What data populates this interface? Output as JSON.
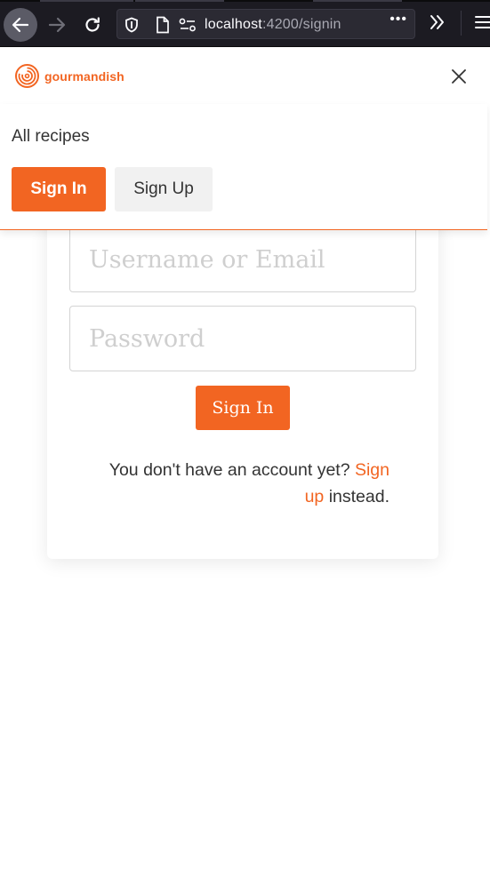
{
  "browser": {
    "url_host": "localhost",
    "url_rest": ":4200/signin",
    "url_more": "•••",
    "icons": [
      "back-arrow-icon",
      "forward-arrow-icon",
      "reload-icon",
      "shield-icon",
      "page-icon",
      "permissions-icon",
      "more-actions-icon",
      "overflow-chevrons-icon",
      "hamburger-menu-icon"
    ]
  },
  "header": {
    "logo_text": "gourmandish",
    "brand_color": "#f26522"
  },
  "menu": {
    "all_recipes": "All recipes",
    "sign_in": "Sign In",
    "sign_up": "Sign Up"
  },
  "signin_form": {
    "username_placeholder": "Username or Email",
    "username_value": "",
    "password_placeholder": "Password",
    "password_value": "",
    "submit_label": "Sign In",
    "note_prefix": "You don't have an account yet? ",
    "note_link": "Sign up",
    "note_suffix": " instead."
  }
}
